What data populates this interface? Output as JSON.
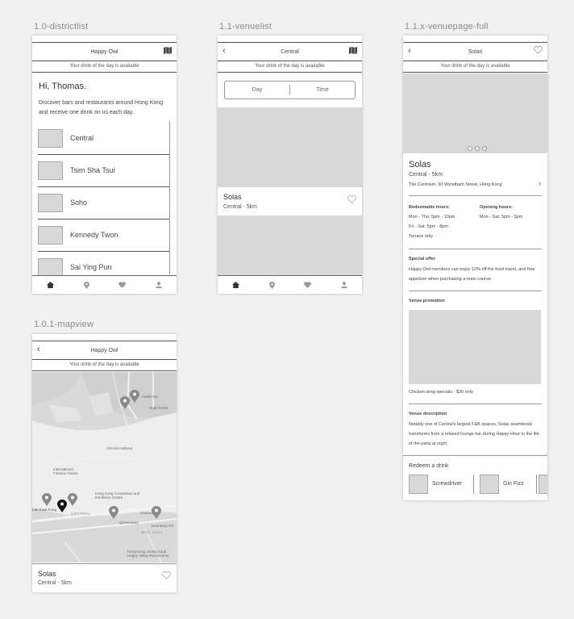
{
  "frames": {
    "districtlist": "1.0-districtlist",
    "venuelist": "1.1-venuelist",
    "venuepage": "1.1.x-venuepage-full",
    "mapview": "1.0.1-mapview"
  },
  "app": {
    "title": "Happy Owl",
    "drink_banner": "Your drink of the day is available"
  },
  "districtlist": {
    "greeting": "Hi, Thomas.",
    "intro": "Discover bars and restaurants around Hong Kong and receive one drink on us each day.",
    "districts": [
      "Central",
      "Tsim Sha Tsui",
      "Soho",
      "Kennedy Twon",
      "Sai Ying Pun"
    ]
  },
  "venuelist": {
    "title": "Central",
    "filter_day": "Day",
    "filter_time": "Time",
    "venue_name": "Solas",
    "venue_meta": "Central - 5km"
  },
  "venuepage": {
    "title": "Solas",
    "name": "Solas",
    "meta": "Central - 5km",
    "address": "The Centrium, 60 Wyndham Street, Hong Kong",
    "redeem_hours_title": "Redeemable hours:",
    "redeem_hours": [
      "Mon - Thu: 5pm - 10pm",
      "Fri - Sat: 5pm - 8pm",
      "Terrace only"
    ],
    "open_hours_title": "Opening hours:",
    "open_hours": [
      "Mon - Sat: 5pm - 5pm"
    ],
    "offer_title": "Special offer",
    "offer_text": "Happy Owl members can enjoy 10% off the food menu, and free appetizer when purchasing a main course.",
    "promo_title": "Venue promotion",
    "promo_caption": "Chicken wing specials - $30 only",
    "desc_title": "Venue description",
    "desc_text": "Notably one of Central's largest F&B spaces, Solas seamlessly transforms from a relaxed lounge bar during Happy Hour to the life of the party at night.",
    "redeem_title": "Redeem a drink",
    "drinks": [
      "Screwdriver",
      "Gin Fizz"
    ]
  },
  "mapview": {
    "title": "Happy Owl",
    "venue_name": "Solas",
    "venue_meta": "Central - 5km",
    "map_labels": [
      "Austin Rd",
      "Hotel ICON",
      "Victoria Harbour",
      "International Finance Centre",
      "Hong Kong Convention and Exhibition Centre",
      "Lan Kwai Fong",
      "CENTRAL",
      "WAN CHAI",
      "Queensway",
      "Harbour Rd",
      "Hennessy Rd",
      "Hong Kong Jockey Club Happy Valley Racecourse"
    ]
  },
  "icons": {
    "home": "home-icon",
    "map_marker": "map-marker-icon",
    "heart": "heart-icon",
    "user": "user-icon",
    "map": "map-icon",
    "back": "back-chevron-icon"
  }
}
